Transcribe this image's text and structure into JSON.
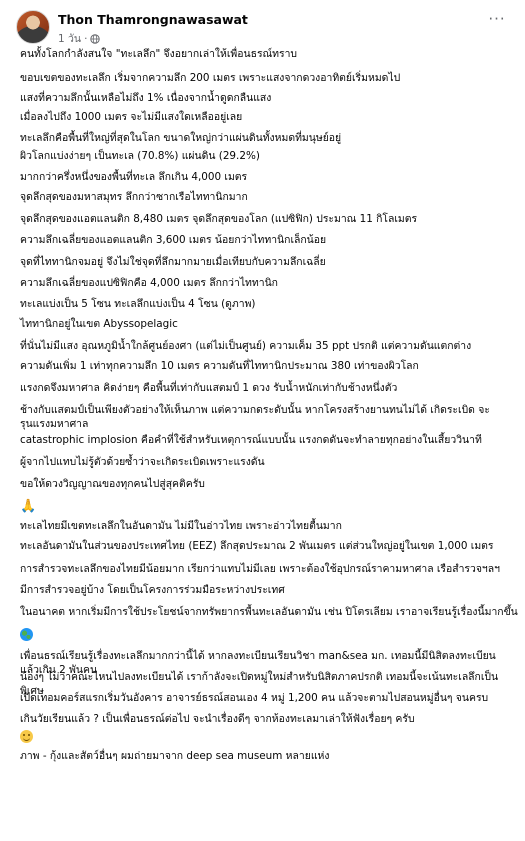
{
  "post": {
    "author": "Thon Thamrongnawasawat",
    "time": "1 วัน",
    "privacy_icon": "globe-icon",
    "more_icon": "more-options-icon",
    "more_label": "···"
  },
  "lines": [
    "คนทั้งโลกกำลังสนใจ \"ทะเลลึก\" จึงอยากเล่าให้เพื่อนธรณ์ทราบ",
    "ขอบเขตของทะเลลึก เริ่มจากความลึก 200 เมตร เพราะแสงจากดวงอาทิตย์เริ่มหมดไป",
    "แสงที่ความลึกนั้นเหลือไม่ถึง 1% เนื่องจากน้ำดูดกลืนแสง",
    "เมื่อลงไปถึง 1000 เมตร จะไม่มีแสงใดเหลืออยู่เลย",
    "ทะเลลึกคือพื้นที่ใหญ่ที่สุดในโลก ขนาดใหญ่กว่าแผ่นดินทั้งหมดที่มนุษย์อยู่",
    "ผิวโลกแบ่งง่ายๆ เป็นทะเล (70.8%) แผ่นดิน (29.2%)",
    "มากกว่าครึ่งหนึ่งของพื้นที่ทะเล ลึกเกิน 4,000 เมตร",
    "จุดลึกสุดของมหาสมุทร ลึกกว่าซากเรือไททานิกมาก",
    "จุดลึกสุดของแอตแลนติก 8,480 เมตร จุดลึกสุดของโลก (แปซิฟิก) ประมาณ 11 กิโลเมตร",
    "ความลึกเฉลี่ยของแอตแลนติก 3,600 เมตร น้อยกว่าไททานิกเล็กน้อย",
    "จุดที่ไททานิกจมอยู่ จึงไม่ใช่จุดที่ลึกมากมายเมื่อเทียบกับความลึกเฉลี่ย",
    "ความลึกเฉลี่ยของแปซิฟิกคือ 4,000 เมตร ลึกกว่าไททานิก",
    "ทะเลแบ่งเป็น 5 โซน ทะเลลึกแบ่งเป็น 4 โซน (ดูภาพ)",
    "ไททานิกอยู่ในเขต Abyssopelagic",
    "ที่นั่นไม่มีแสง อุณหภูมิน้ำใกล้ศูนย์องศา (แต่ไม่เป็นศูนย์) ความเค็ม 35 ppt ปรกติ แต่ความดันแตกต่าง",
    "ความดันเพิ่ม 1 เท่าทุกความลึก 10 เมตร ความดันที่ไททานิกประมาณ 380 เท่าของผิวโลก",
    "แรงกดจึงมหาศาล คิดง่ายๆ คือพื้นที่เท่ากับแสตมป์ 1 ดวง รับน้ำหนักเท่ากับช้างหนึ่งตัว",
    "ช้างกับแสตมป์เป็นเพียงตัวอย่างให้เห็นภาพ แต่ความกดระดับนั้น หากโครงสร้างยานทนไม่ได้ เกิดระเบิด จะรุนแรงมหาศาล",
    "catastrophic implosion คือคำที่ใช้สำหรับเหตุการณ์แบบนั้น แรงกดดันจะทำลายทุกอย่างในเสี้ยววินาที",
    "ผู้จากไปแทบไม่รู้ตัวด้วยซ้ำว่าจะเกิดระเบิดเพราะแรงดัน",
    "ขอให้ดวงวิญญาณของทุกคนไปสู่สุคติครับ",
    "🙏",
    "ทะเลไทยมีเขตทะเลลึกในอันดามัน ไม่มีในอ่าวไทย เพราะอ่าวไทยตื้นมาก",
    "ทะเลอันดามันในส่วนของประเทศไทย (EEZ) ลึกสุดประมาณ 2 พันเมตร แต่ส่วนใหญ่อยู่ในเขต 1,000 เมตร",
    "การสำรวจทะเลลึกของไทยมีน้อยมาก เรียกว่าแทบไม่มีเลย เพราะต้องใช้อุปกรณ์ราคามหาศาล เรือสำรวจฯลฯ",
    "มีการสำรวจอยู่บ้าง โดยเป็นโครงการร่วมมือระหว่างประเทศ",
    "ในอนาคต หากเริ่มมีการใช้ประโยชน์จากทรัพยากรพื้นทะเลอันดามัน เช่น ปิโตรเลียม เราอาจเรียนรู้เรื่องนี้มากขึ้น",
    "🌏",
    "เพื่อนธรณ์เรียนรู้เรื่องทะเลลึกมากกว่านี้ได้ หากลงทะเบียนเรียนวิชา man&sea มก. เทอมนี้มีนิสิตลงทะเบียนแล้วเกิน 2 พันคน",
    "น้องๆ ไม่ว่าคณะไหนไปลงทะเบียนได้ เราก้าลังจะเปิดหมู่ใหม่สำหรับนิสิตภาคปรกติ เทอมนี้จะเน้นทะเลลึกเป็นพิเศษ",
    "เปิดเทอมคอร์สแรกเริ่มวันอังคาร อาจารย์ธรณ์สอนเอง 4 หมู่ 1,200 คน แล้วจะตามไปสอนหมู่อื่นๆ จนครบ",
    "เกินวัยเรียนแล้ว ? เป็นเพื่อนธรณ์ต่อไป จะนำเรื่องดีๆ จากห้องทะเลมาเล่าให้ฟังเรื่อยๆ ครับ",
    "😊",
    "ภาพ - กุ้งและสัตว์อื่นๆ ผมถ่ายมาจาก deep sea museum หลายแห่ง"
  ]
}
